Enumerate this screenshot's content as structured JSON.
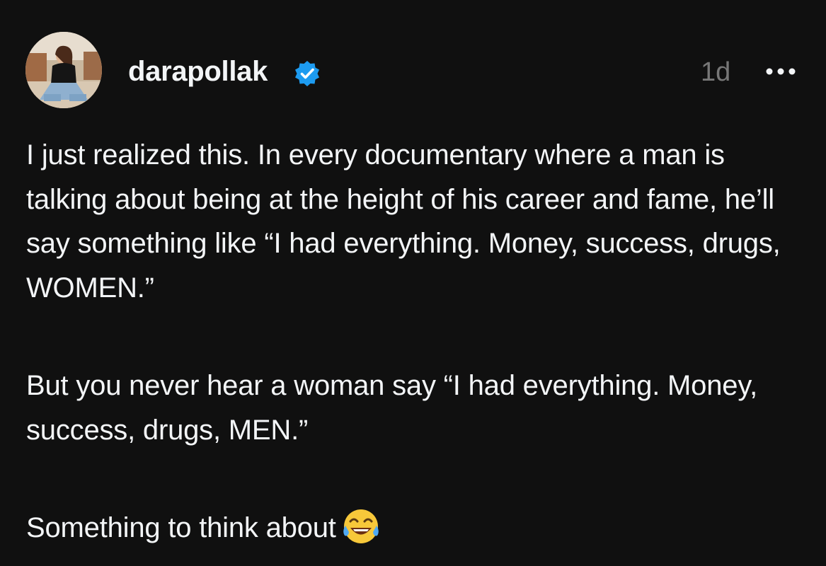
{
  "post": {
    "username": "darapollak",
    "verified_icon": "verified-badge-icon",
    "timestamp": "1d",
    "more_icon": "ellipsis-icon",
    "paragraphs": [
      "I just realized this. In every documentary where a man is talking about being at the height of his career and fame, he’ll say something like “I had everything. Money, success, drugs, WOMEN.”",
      "But you never hear a woman say “I had everything. Money, success, drugs, MEN.”",
      "Something to think about"
    ],
    "emoji_icon": "tears-of-joy-emoji-icon"
  },
  "colors": {
    "background": "#101010",
    "text": "#f3f5f7",
    "muted": "#777777",
    "verified": "#1d9bf0"
  }
}
